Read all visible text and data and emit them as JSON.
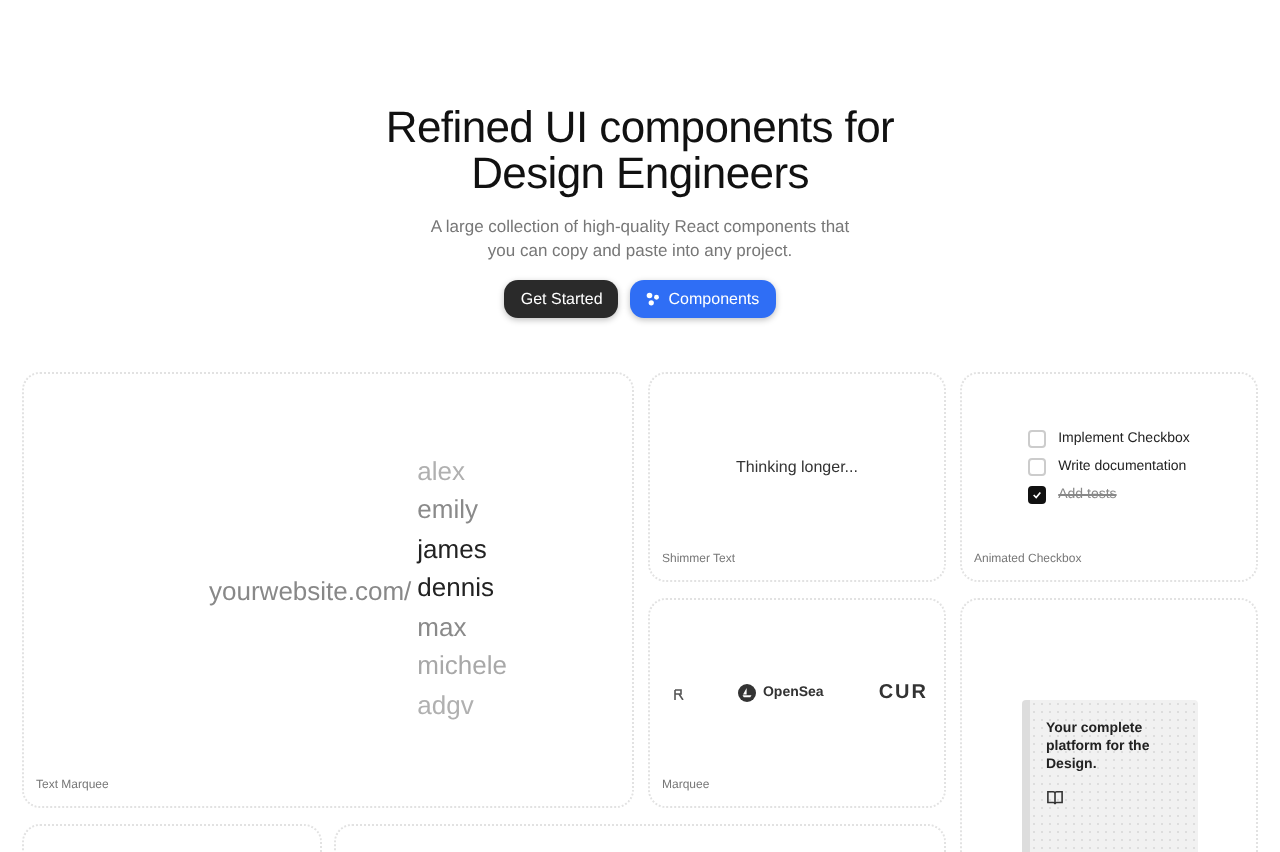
{
  "hero": {
    "title_lines": [
      "Refined UI components for",
      "Design Engineers"
    ],
    "subtitle_lines": [
      "A large collection of high-quality React components that",
      "you can copy and paste into any project."
    ],
    "buttons": [
      {
        "label": "Get Started",
        "kind": "dark"
      },
      {
        "label": "Components",
        "kind": "primary"
      }
    ]
  },
  "text_marquee": {
    "prefix": "yourwebsite.com/",
    "names": [
      {
        "text": "alex",
        "kind": "faint"
      },
      {
        "text": "emily",
        "kind": "muted"
      },
      {
        "text": "james",
        "kind": "strong"
      },
      {
        "text": "dennis",
        "kind": "strong"
      },
      {
        "text": "max",
        "kind": "muted"
      },
      {
        "text": "michele",
        "kind": "light"
      },
      {
        "text": "adgv",
        "kind": "faint"
      }
    ],
    "caption": "Text Marquee"
  },
  "shimmer": {
    "text": "Thinking longer...",
    "caption": "Shimmer Text"
  },
  "checkbox_demo": {
    "items": [
      {
        "label": "Implement Checkbox",
        "checked": false
      },
      {
        "label": "Write documentation",
        "checked": false
      },
      {
        "label": "Add tests",
        "checked": true
      }
    ],
    "caption": "Animated Checkbox"
  },
  "marquee": {
    "logos": [
      "OpenSea",
      "CUR"
    ],
    "caption": "Marquee"
  },
  "book": {
    "text": "Your complete platform for the Design."
  }
}
